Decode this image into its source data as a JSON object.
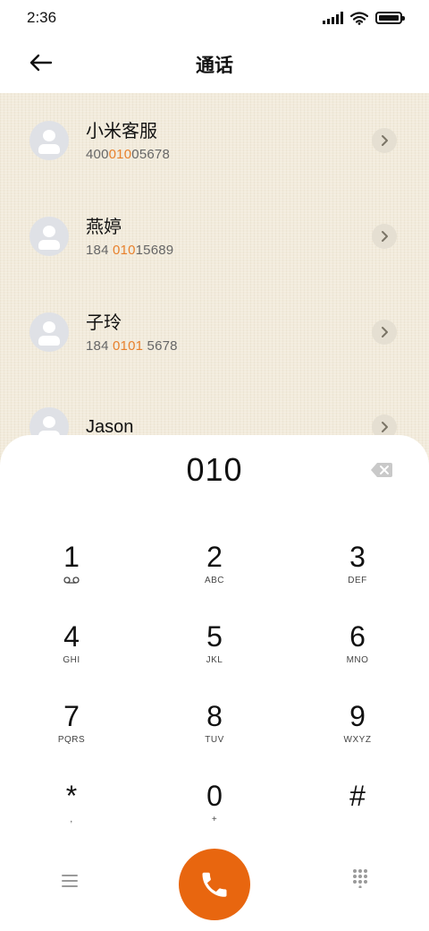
{
  "status_bar": {
    "time": "2:36"
  },
  "header": {
    "title": "通话"
  },
  "contacts": [
    {
      "name": "小米客服",
      "num_pre": "400",
      "num_hl": "010",
      "num_post": "05678"
    },
    {
      "name": "燕婷",
      "num_pre": "184 ",
      "num_hl": "010",
      "num_post": "15689"
    },
    {
      "name": "子玲",
      "num_pre": "184 ",
      "num_hl": "0101",
      "num_post": " 5678"
    },
    {
      "name": "Jason",
      "num_pre": "",
      "num_hl": "",
      "num_post": ""
    }
  ],
  "dialer": {
    "input": "010",
    "keys": [
      {
        "digit": "1",
        "letters": ""
      },
      {
        "digit": "2",
        "letters": "ABC"
      },
      {
        "digit": "3",
        "letters": "DEF"
      },
      {
        "digit": "4",
        "letters": "GHI"
      },
      {
        "digit": "5",
        "letters": "JKL"
      },
      {
        "digit": "6",
        "letters": "MNO"
      },
      {
        "digit": "7",
        "letters": "PQRS"
      },
      {
        "digit": "8",
        "letters": "TUV"
      },
      {
        "digit": "9",
        "letters": "WXYZ"
      },
      {
        "digit": "*",
        "letters": ","
      },
      {
        "digit": "0",
        "letters": "+"
      },
      {
        "digit": "#",
        "letters": ""
      }
    ]
  },
  "colors": {
    "accent": "#e8660f",
    "highlight": "#e8812d",
    "list_bg": "#f2ebdc"
  }
}
